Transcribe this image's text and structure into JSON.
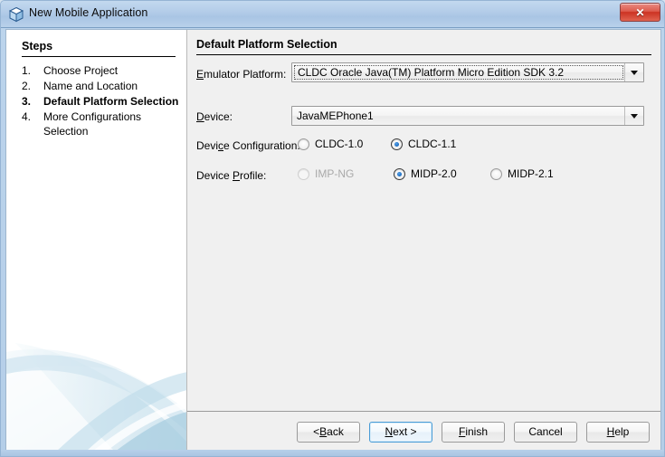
{
  "window": {
    "title": "New Mobile Application",
    "icon": "cube-icon",
    "close_label": "✕"
  },
  "steps": {
    "heading": "Steps",
    "items": [
      {
        "num": "1.",
        "label": "Choose Project",
        "current": false
      },
      {
        "num": "2.",
        "label": "Name and Location",
        "current": false
      },
      {
        "num": "3.",
        "label": "Default Platform Selection",
        "current": true
      },
      {
        "num": "4.",
        "label": "More Configurations Selection",
        "current": false
      }
    ]
  },
  "main": {
    "title": "Default Platform Selection",
    "emulator_platform": {
      "label_pre": "",
      "label_mnemonic": "E",
      "label_post": "mulator Platform:",
      "value": "CLDC Oracle Java(TM) Platform Micro Edition SDK 3.2",
      "focused": true
    },
    "device": {
      "label_pre": "",
      "label_mnemonic": "D",
      "label_post": "evice:",
      "value": "JavaMEPhone1",
      "focused": false
    },
    "device_configuration": {
      "label_pre": "Devi",
      "label_mnemonic": "c",
      "label_post": "e Configuration:",
      "options": [
        {
          "label": "CLDC-1.0",
          "checked": false,
          "disabled": false
        },
        {
          "label": "CLDC-1.1",
          "checked": true,
          "disabled": false
        }
      ]
    },
    "device_profile": {
      "label_pre": "Device ",
      "label_mnemonic": "P",
      "label_post": "rofile:",
      "options": [
        {
          "label": "IMP-NG",
          "checked": false,
          "disabled": true
        },
        {
          "label": "MIDP-2.0",
          "checked": true,
          "disabled": false
        },
        {
          "label": "MIDP-2.1",
          "checked": false,
          "disabled": false
        }
      ]
    }
  },
  "buttons": [
    {
      "name": "back",
      "pre": "< ",
      "mnemonic": "B",
      "post": "ack",
      "default": false
    },
    {
      "name": "next",
      "pre": "",
      "mnemonic": "N",
      "post": "ext >",
      "default": true
    },
    {
      "name": "finish",
      "pre": "",
      "mnemonic": "F",
      "post": "inish",
      "default": false
    },
    {
      "name": "cancel",
      "pre": "Cancel",
      "mnemonic": "",
      "post": "",
      "default": false
    },
    {
      "name": "help",
      "pre": "",
      "mnemonic": "H",
      "post": "elp",
      "default": false
    }
  ],
  "colors": {
    "titlebar": "#aec8e6",
    "close": "#cc3222",
    "panel": "#f0f0f0",
    "steps_bg": "#ffffff",
    "accent": "#1669c0",
    "swoosh": "#c3dcea"
  }
}
